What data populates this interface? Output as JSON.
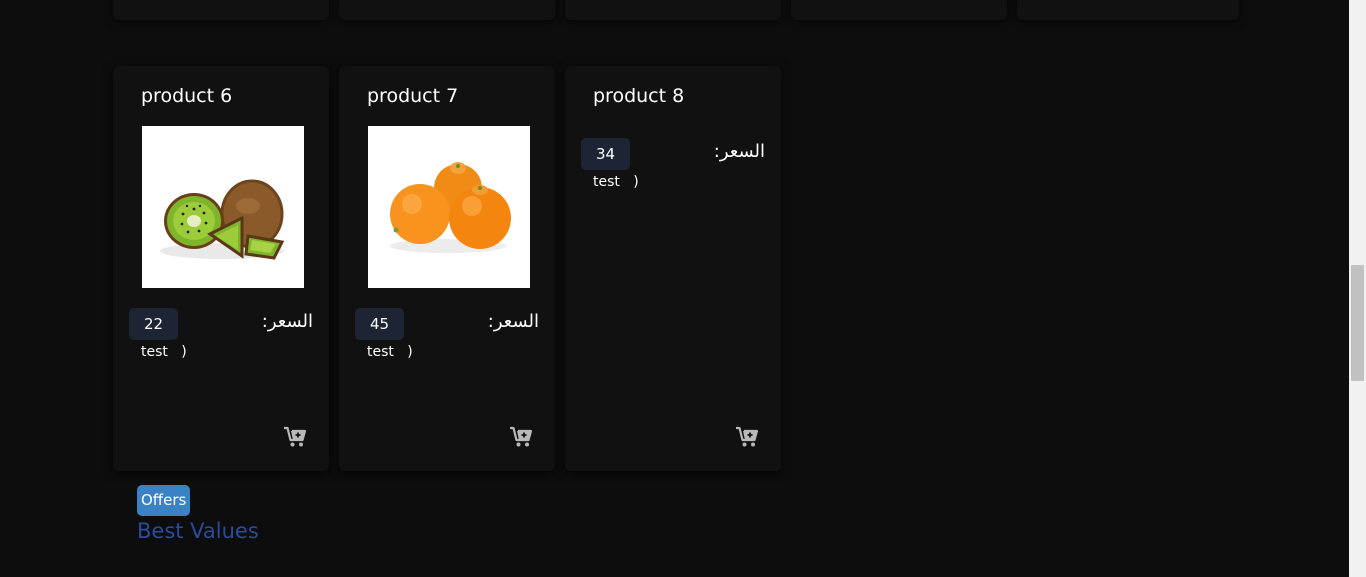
{
  "products": [
    {
      "title": "product 6",
      "image": "kiwi-image",
      "price": "22",
      "price_label": "السعر:",
      "desc": "test   )"
    },
    {
      "title": "product 7",
      "image": "tangerine-image",
      "price": "45",
      "price_label": "السعر:",
      "desc": "test   )"
    },
    {
      "title": "product 8",
      "image": "",
      "price": "34",
      "price_label": "السعر:",
      "desc": "test   )"
    }
  ],
  "icons": {
    "cart": "add-to-cart-icon"
  },
  "section": {
    "badge": "Offers",
    "heading": "Best Values"
  },
  "colors": {
    "background": "#0d0d0d",
    "card": "#111111",
    "price_badge": "#1d2535",
    "offers_badge": "#3b82c4",
    "heading": "#2a4a9a"
  }
}
